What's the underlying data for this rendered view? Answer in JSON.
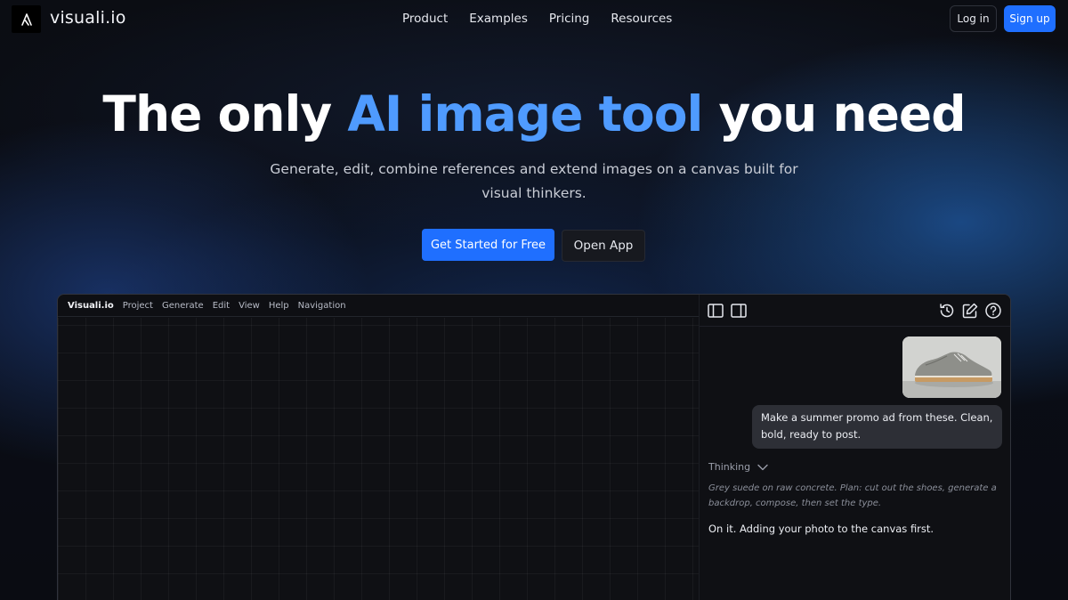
{
  "nav": {
    "brand": "visuali.io",
    "links": [
      "Product",
      "Examples",
      "Pricing",
      "Resources"
    ],
    "login_label": "Log in",
    "signup_label": "Sign up",
    "logo_icon": "visuali-logo-icon"
  },
  "hero": {
    "title_pre": "The only ",
    "title_accent": "AI image tool",
    "title_post": " you need",
    "subtitle": "Generate, edit, combine references and extend images on a canvas built for visual thinkers.",
    "cta_primary": "Get Started for Free",
    "cta_secondary": "Open App",
    "accent_color": "#4f9bff",
    "button_color": "#1f6fff"
  },
  "app": {
    "brand": "Visuali.io",
    "menu": [
      "Project",
      "Generate",
      "Edit",
      "View",
      "Help",
      "Navigation"
    ],
    "toolbar_icons": [
      "panel-left-icon",
      "panel-right-icon",
      "history-icon",
      "edit-icon",
      "help-icon"
    ],
    "chat": {
      "attachment_icon": "shoe-photo",
      "user_message": "Make a summer promo ad from these. Clean, bold, ready to post.",
      "thinking_label": "Thinking",
      "thought": "Grey suede on raw concrete. Plan: cut out the shoes, generate a backdrop, compose, then set the type.",
      "reply": "On it. Adding your photo to the canvas first."
    }
  }
}
